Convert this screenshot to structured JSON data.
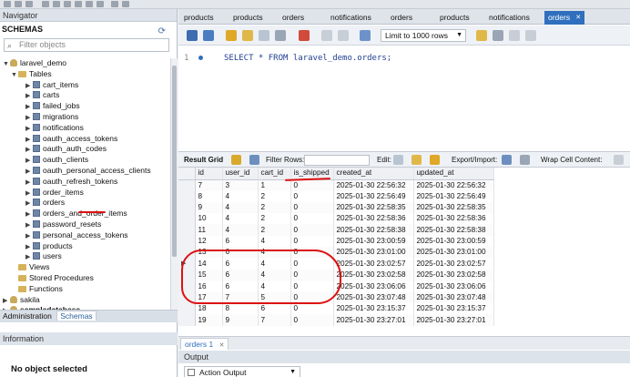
{
  "left": {
    "navigator_label": "Navigator",
    "schemas_label": "SCHEMAS",
    "filter_placeholder": "Filter objects",
    "tree": {
      "db": "laravel_demo",
      "tables_folder": "Tables",
      "tables": [
        "cart_items",
        "carts",
        "failed_jobs",
        "migrations",
        "notifications",
        "oauth_access_tokens",
        "oauth_auth_codes",
        "oauth_clients",
        "oauth_personal_access_clients",
        "oauth_refresh_tokens",
        "order_items",
        "orders",
        "orders_and_order_items",
        "password_resets",
        "personal_access_tokens",
        "products",
        "users"
      ],
      "views": "Views",
      "stored_procedures": "Stored Procedures",
      "functions": "Functions",
      "other_db_1": "sakila",
      "other_db_2": "sampledatabase"
    },
    "bottom_tabs": [
      "Administration",
      "Schemas"
    ],
    "information_label": "Information",
    "no_object": "No object selected"
  },
  "right": {
    "tabs": [
      "products",
      "products",
      "orders",
      "notifications",
      "orders",
      "products",
      "notifications",
      "orders"
    ],
    "active_tab_close": "✕",
    "limit": "Limit to 1000 rows",
    "line_number": "1",
    "sql": "SELECT * FROM laravel_demo.orders;",
    "result_toolbar": {
      "result_grid": "Result Grid",
      "filter_rows": "Filter Rows:",
      "edit": "Edit:",
      "export": "Export/Import:",
      "wrap": "Wrap Cell Content:"
    },
    "columns": [
      "id",
      "user_id",
      "cart_id",
      "is_shipped",
      "created_at",
      "updated_at"
    ],
    "rows": [
      [
        "7",
        "3",
        "1",
        "0",
        "2025-01-30 22:56:32",
        "2025-01-30 22:56:32"
      ],
      [
        "8",
        "4",
        "2",
        "0",
        "2025-01-30 22:56:49",
        "2025-01-30 22:56:49"
      ],
      [
        "9",
        "4",
        "2",
        "0",
        "2025-01-30 22:58:35",
        "2025-01-30 22:58:35"
      ],
      [
        "10",
        "4",
        "2",
        "0",
        "2025-01-30 22:58:36",
        "2025-01-30 22:58:36"
      ],
      [
        "11",
        "4",
        "2",
        "0",
        "2025-01-30 22:58:38",
        "2025-01-30 22:58:38"
      ],
      [
        "12",
        "6",
        "4",
        "0",
        "2025-01-30 23:00:59",
        "2025-01-30 23:00:59"
      ],
      [
        "13",
        "6",
        "4",
        "0",
        "2025-01-30 23:01:00",
        "2025-01-30 23:01:00"
      ],
      [
        "14",
        "6",
        "4",
        "0",
        "2025-01-30 23:02:57",
        "2025-01-30 23:02:57"
      ],
      [
        "15",
        "6",
        "4",
        "0",
        "2025-01-30 23:02:58",
        "2025-01-30 23:02:58"
      ],
      [
        "16",
        "6",
        "4",
        "0",
        "2025-01-30 23:06:06",
        "2025-01-30 23:06:06"
      ],
      [
        "17",
        "7",
        "5",
        "0",
        "2025-01-30 23:07:48",
        "2025-01-30 23:07:48"
      ],
      [
        "18",
        "8",
        "6",
        "0",
        "2025-01-30 23:15:37",
        "2025-01-30 23:15:37"
      ],
      [
        "19",
        "9",
        "7",
        "0",
        "2025-01-30 23:27:01",
        "2025-01-30 23:27:01"
      ]
    ],
    "result_tab": "orders 1",
    "result_tab_close": "✕",
    "output_label": "Output",
    "output_select": "Action Output"
  }
}
